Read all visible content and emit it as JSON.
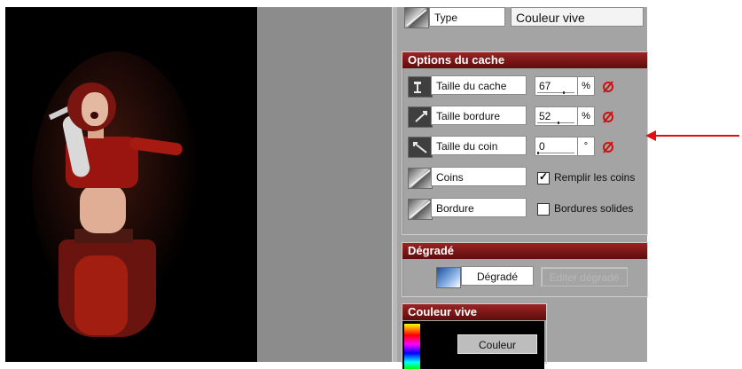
{
  "type_row": {
    "label": "Type",
    "value": "Couleur vive"
  },
  "mask_options": {
    "title": "Options du cache",
    "rows": [
      {
        "label": "Taille du cache",
        "value": "67",
        "unit": "%",
        "slider_fraction": 0.67
      },
      {
        "label": "Taille bordure",
        "value": "52",
        "unit": "%",
        "slider_fraction": 0.52
      },
      {
        "label": "Taille du coin",
        "value": "0",
        "unit": "°",
        "slider_fraction": 0.0
      }
    ],
    "corners": {
      "label": "Coins",
      "checkbox_label": "Remplir les coins",
      "checked": true
    },
    "border": {
      "label": "Bordure",
      "checkbox_label": "Bordures solides",
      "checked": false
    }
  },
  "gradient": {
    "title": "Dégradé",
    "label": "Dégradé",
    "edit_button": "Editer dégradé"
  },
  "vivid_color": {
    "title": "Couleur vive",
    "button": "Couleur"
  },
  "colors": {
    "header_red": "#7a1414",
    "panel_gray": "#a4a4a4",
    "workspace_gray": "#8c8c8c",
    "null_red": "#d01010",
    "arrow_red": "#e01010"
  }
}
